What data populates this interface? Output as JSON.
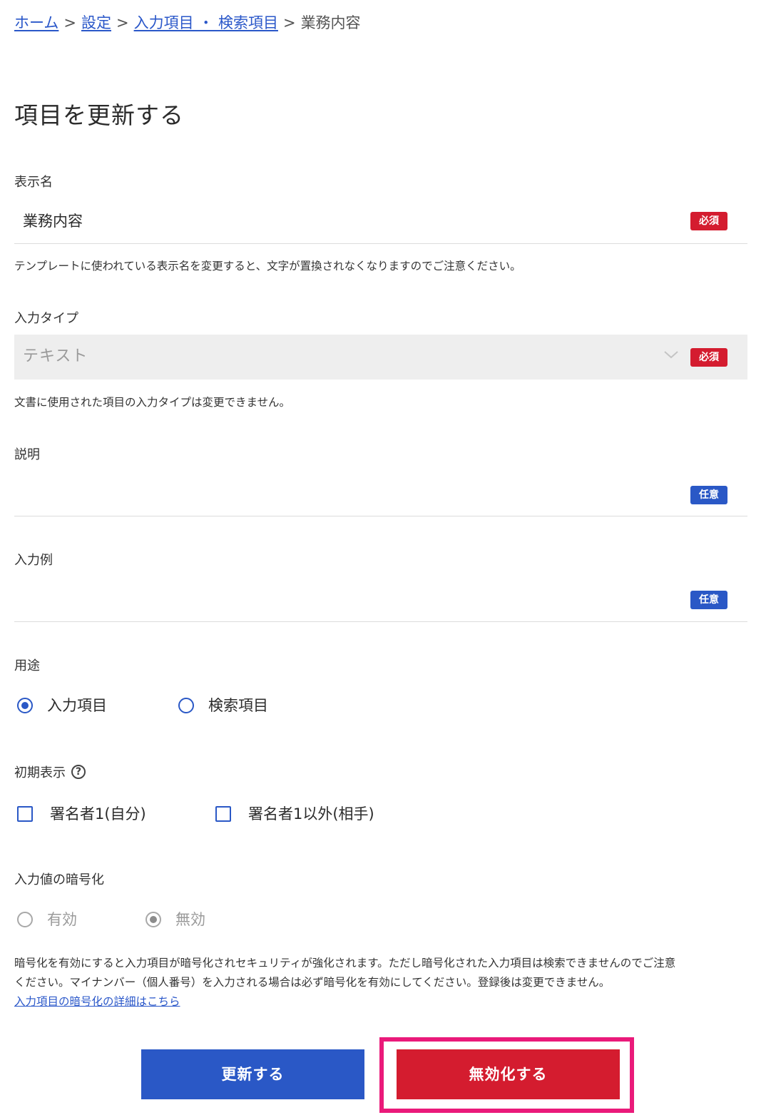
{
  "breadcrumb": {
    "items": [
      "ホーム",
      "設定",
      "入力項目 ・ 検索項目"
    ],
    "separator": ">",
    "current": "業務内容"
  },
  "page": {
    "title": "項目を更新する"
  },
  "badges": {
    "required": "必須",
    "optional": "任意"
  },
  "display_name": {
    "label": "表示名",
    "value": "業務内容",
    "help": "テンプレートに使われている表示名を変更すると、文字が置換されなくなりますのでご注意ください。"
  },
  "input_type": {
    "label": "入力タイプ",
    "value": "テキスト",
    "help": "文書に使用された項目の入力タイプは変更できません。"
  },
  "description": {
    "label": "説明",
    "value": ""
  },
  "example": {
    "label": "入力例",
    "value": ""
  },
  "usage": {
    "label": "用途",
    "options": [
      "入力項目",
      "検索項目"
    ],
    "selected": "入力項目"
  },
  "initial_display": {
    "label": "初期表示",
    "help_icon": "question-circle-icon",
    "options": [
      "署名者1(自分)",
      "署名者1以外(相手)"
    ]
  },
  "encryption": {
    "label": "入力値の暗号化",
    "options": [
      "有効",
      "無効"
    ],
    "selected": "無効",
    "help_line1": "暗号化を有効にすると入力項目が暗号化されセキュリティが強化されます。ただし暗号化された入力項目は検索できませんのでご注意",
    "help_line2": "ください。マイナンバー（個人番号）を入力される場合は必ず暗号化を有効にしてください。登録後は変更できません。",
    "link": "入力項目の暗号化の詳細はこちら"
  },
  "actions": {
    "update": "更新する",
    "disable": "無効化する"
  },
  "colors": {
    "primary": "#2a58c6",
    "danger": "#d41c2f",
    "highlight": "#ea1a7a",
    "link": "#2a57c9"
  }
}
